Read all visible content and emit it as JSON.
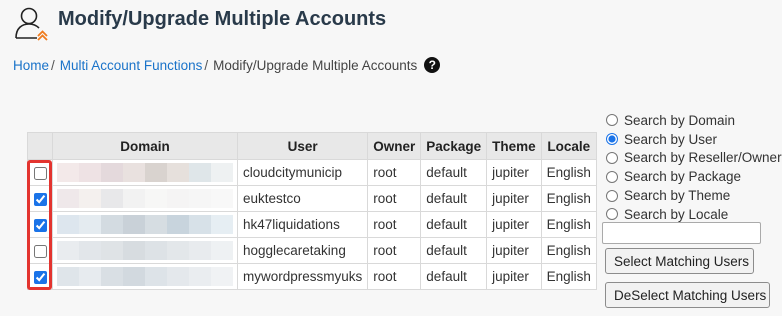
{
  "page": {
    "title": "Modify/Upgrade Multiple Accounts"
  },
  "breadcrumb": {
    "home": "Home",
    "section": "Multi Account Functions",
    "current": "Modify/Upgrade Multiple Accounts",
    "help_glyph": "?"
  },
  "table": {
    "headers": {
      "domain": "Domain",
      "user": "User",
      "owner": "Owner",
      "package": "Package",
      "theme": "Theme",
      "locale": "Locale"
    },
    "rows": [
      {
        "checked": false,
        "domain_redacted": true,
        "user": "cloudcitymunicip",
        "owner": "root",
        "package": "default",
        "theme": "jupiter",
        "locale": "English"
      },
      {
        "checked": true,
        "domain_redacted": true,
        "user": "euktestco",
        "owner": "root",
        "package": "default",
        "theme": "jupiter",
        "locale": "English"
      },
      {
        "checked": true,
        "domain_redacted": true,
        "user": "hk47liquidations",
        "owner": "root",
        "package": "default",
        "theme": "jupiter",
        "locale": "English"
      },
      {
        "checked": false,
        "domain_redacted": true,
        "user": "hogglecaretaking",
        "owner": "root",
        "package": "default",
        "theme": "jupiter",
        "locale": "English"
      },
      {
        "checked": true,
        "domain_redacted": true,
        "user": "mywordpressmyuks",
        "owner": "root",
        "package": "default",
        "theme": "jupiter",
        "locale": "English"
      }
    ]
  },
  "search": {
    "options": [
      {
        "label": "Search by Domain",
        "selected": false
      },
      {
        "label": "Search by User",
        "selected": true
      },
      {
        "label": "Search by Reseller/Owner",
        "selected": false
      },
      {
        "label": "Search by Package",
        "selected": false
      },
      {
        "label": "Search by Theme",
        "selected": false
      },
      {
        "label": "Search by Locale",
        "selected": false
      }
    ],
    "query": "",
    "select_button": "Select Matching Users",
    "deselect_button": "DeSelect Matching Users"
  },
  "colors": {
    "accent": "#1a73c9",
    "highlight_border": "#e3342f",
    "header_bg": "#e8e8e8"
  }
}
